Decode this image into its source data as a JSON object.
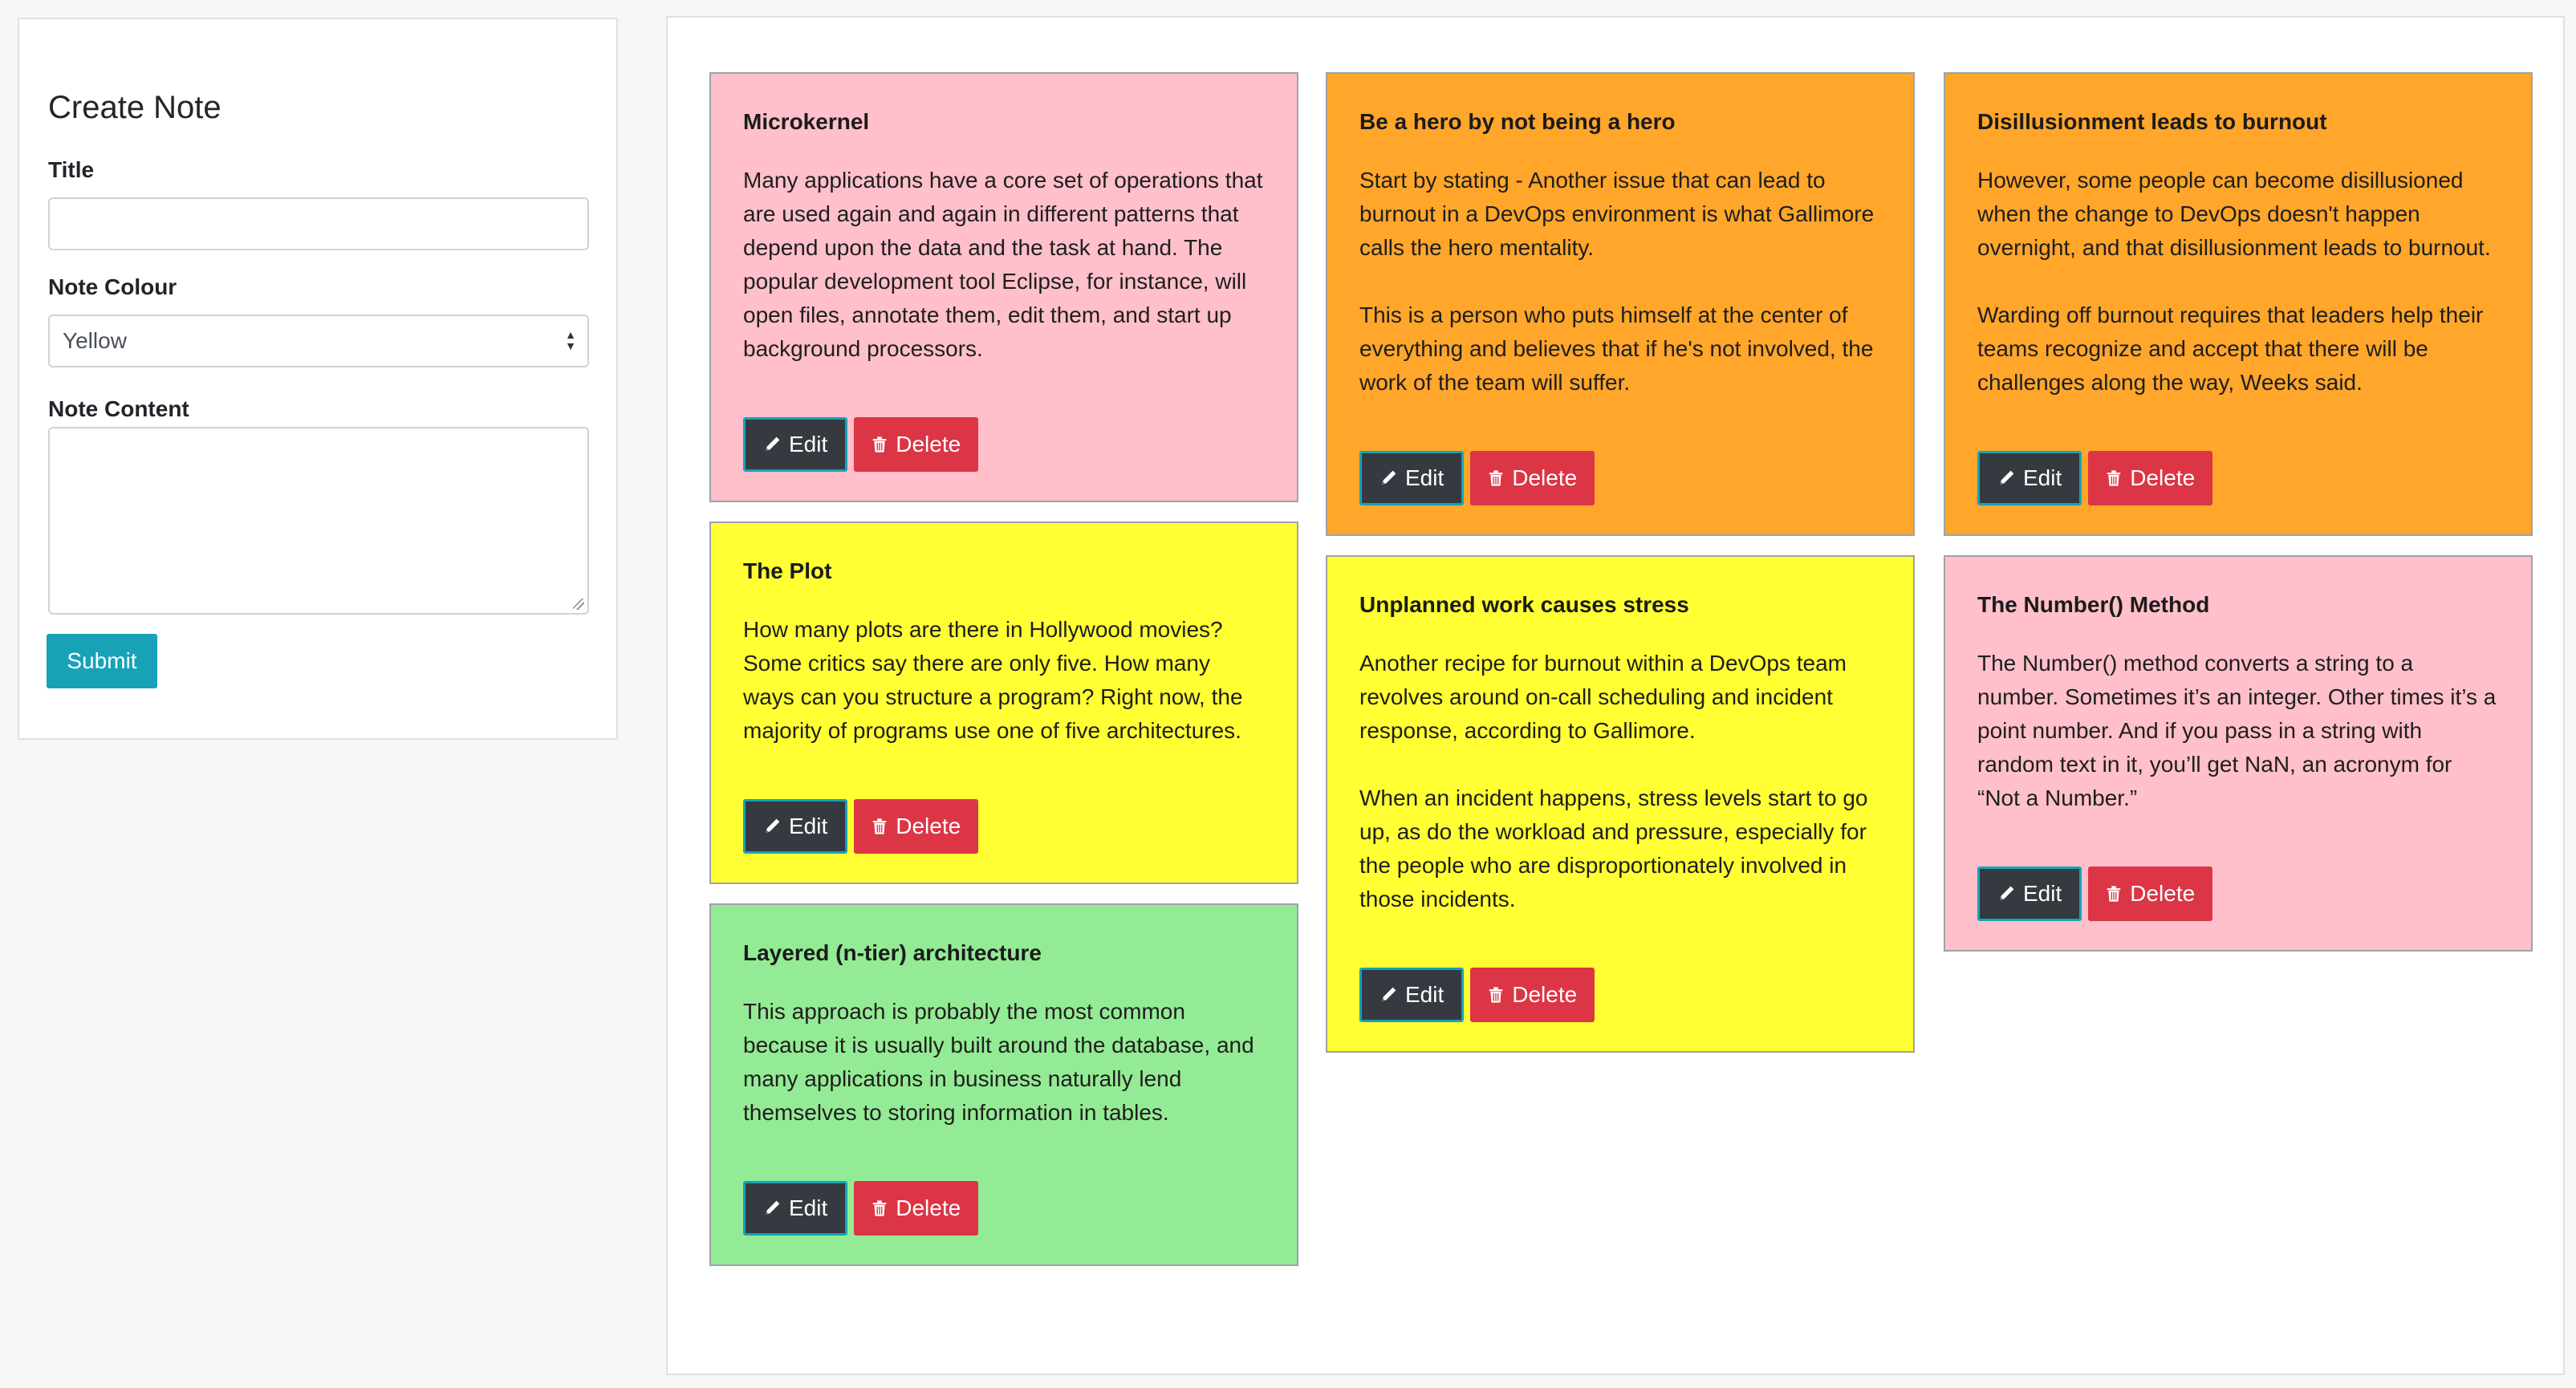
{
  "create_form": {
    "heading": "Create Note",
    "title_label": "Title",
    "title_value": "",
    "colour_label": "Note Colour",
    "colour_selected": "Yellow",
    "content_label": "Note Content",
    "content_value": "",
    "submit_label": "Submit"
  },
  "actions": {
    "edit_label": "Edit",
    "delete_label": "Delete"
  },
  "notes": [
    {
      "colour": "pink",
      "title": "Microkernel",
      "content": "Many applications have a core set of operations that are used again and again in different patterns that depend upon the data and the task at hand. The popular development tool Eclipse, for instance, will open files, annotate them, edit them, and start up background processors."
    },
    {
      "colour": "yellow",
      "title": "The Plot",
      "content": "How many plots are there in Hollywood movies? Some critics say there are only five. How many ways can you structure a program? Right now, the majority of programs use one of five architectures."
    },
    {
      "colour": "green",
      "title": "Layered (n-tier) architecture",
      "content": "This approach is probably the most common because it is usually built around the database, and many applications in business naturally lend themselves to storing information in tables."
    },
    {
      "colour": "orange",
      "title": "Be a hero by not being a hero",
      "content": "Start by stating - Another issue that can lead to burnout in a DevOps environment is what Gallimore calls the hero mentality.\n\nThis is a person who puts himself at the center of everything and believes that if he's not involved, the work of the team will suffer."
    },
    {
      "colour": "yellow",
      "title": "Unplanned work causes stress",
      "content": "Another recipe for burnout within a DevOps team revolves around on-call scheduling and incident response, according to Gallimore.\n\nWhen an incident happens, stress levels start to go up, as do the workload and pressure, especially for the people who are disproportionately involved in those incidents."
    },
    {
      "colour": "orange",
      "title": "Disillusionment leads to burnout",
      "content": "However, some people can become disillusioned when the change to DevOps doesn't happen overnight, and that disillusionment leads to burnout.\n\nWarding off burnout requires that leaders help their teams recognize and accept that there will be challenges along the way, Weeks said."
    },
    {
      "colour": "pink",
      "title": "The Number() Method",
      "content": "The Number() method converts a string to a number. Sometimes it’s an integer. Other times it’s a point number. And if you pass in a string with random text in it, you’ll get NaN, an acronym for “Not a Number.”"
    }
  ],
  "colors": {
    "pink": "#ffc0cb",
    "yellow": "#ffff33",
    "orange": "#ffa62b",
    "green": "#94eb95",
    "submit": "#17a2b8",
    "edit": "#343a40",
    "delete": "#dc3545"
  },
  "icons": {
    "edit": "pencil-icon",
    "delete": "trash-icon",
    "select": "select-arrows-icon"
  }
}
